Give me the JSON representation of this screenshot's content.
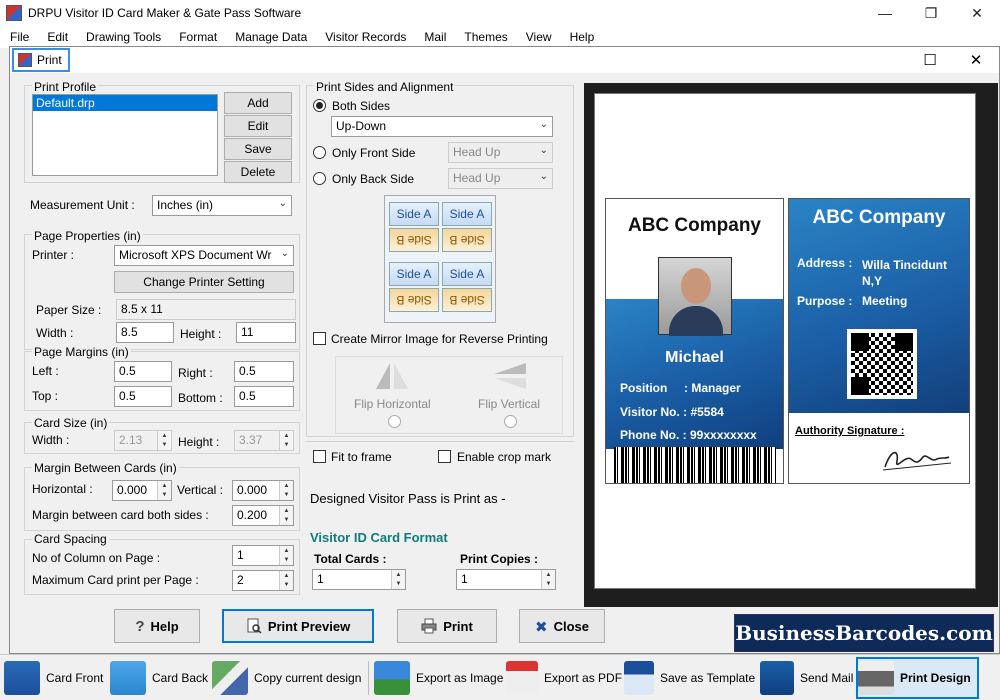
{
  "app": {
    "title": "DRPU Visitor ID Card Maker & Gate Pass Software",
    "menu": [
      "File",
      "Edit",
      "Drawing Tools",
      "Format",
      "Manage Data",
      "Visitor Records",
      "Mail",
      "Themes",
      "View",
      "Help"
    ]
  },
  "dialog": {
    "title": "Print",
    "print_profile": {
      "label": "Print Profile",
      "selected_item": "Default.drp",
      "buttons": [
        "Add",
        "Edit",
        "Save",
        "Delete"
      ]
    },
    "measurement": {
      "label": "Measurement Unit :",
      "value": "Inches (in)"
    },
    "page_properties": {
      "label": "Page Properties (in)",
      "printer_label": "Printer :",
      "printer_value": "Microsoft XPS Document Wr",
      "change_printer": "Change Printer Setting",
      "paper_size_label": "Paper Size :",
      "paper_size_value": "8.5 x 11",
      "width_label": "Width :",
      "width_value": "8.5",
      "height_label": "Height :",
      "height_value": "11"
    },
    "page_margins": {
      "label": "Page Margins (in)",
      "left_label": "Left :",
      "left_value": "0.5",
      "right_label": "Right :",
      "right_value": "0.5",
      "top_label": "Top :",
      "top_value": "0.5",
      "bottom_label": "Bottom :",
      "bottom_value": "0.5"
    },
    "card_size": {
      "label": "Card Size (in)",
      "width_label": "Width :",
      "width_value": "2.13",
      "height_label": "Height :",
      "height_value": "3.37"
    },
    "margin_between": {
      "label": "Margin Between Cards (in)",
      "horizontal_label": "Horizontal :",
      "horizontal_value": "0.000",
      "vertical_label": "Vertical :",
      "vertical_value": "0.000",
      "both_sides_label": "Margin between card both sides :",
      "both_sides_value": "0.200"
    },
    "card_spacing": {
      "label": "Card Spacing",
      "columns_label": "No of Column on Page :",
      "columns_value": "1",
      "max_label": "Maximum Card print per Page :",
      "max_value": "2"
    },
    "print_sides": {
      "label": "Print Sides and Alignment",
      "both_sides": "Both Sides",
      "both_sides_value": "Up-Down",
      "front_only": "Only Front Side",
      "front_value": "Head Up",
      "back_only": "Only Back Side",
      "back_value": "Head Up",
      "side_a": "Side A",
      "side_b": "Side B",
      "mirror": "Create Mirror Image for Reverse Printing",
      "flip_h": "Flip Horizontal",
      "flip_v": "Flip Vertical",
      "fit_frame": "Fit to frame",
      "crop_mark": "Enable crop mark"
    },
    "designed_text": "Designed Visitor Pass is Print as -",
    "format_title": "Visitor ID Card Format",
    "total_cards_label": "Total Cards :",
    "total_cards_value": "1",
    "print_copies_label": "Print Copies :",
    "print_copies_value": "1",
    "buttons": {
      "help": "Help",
      "preview": "Print Preview",
      "print": "Print",
      "close": "Close"
    }
  },
  "card": {
    "front": {
      "company": "ABC Company",
      "name": "Michael",
      "position": "Position     : Manager",
      "visitor_no": "Visitor No. : #5584",
      "phone": "Phone No. : 99xxxxxxxx"
    },
    "back": {
      "company": "ABC Company",
      "address_label": "Address :",
      "address_value_1": "Willa Tincidunt",
      "address_value_2": "N,Y",
      "purpose_label": "Purpose :",
      "purpose_value": "Meeting",
      "signature_label": "Authority Signature :"
    }
  },
  "watermark": "BusinessBarcodes.com",
  "toolbar": {
    "items": [
      "Card Front",
      "Card Back",
      "Copy current design",
      "Export as Image",
      "Export as PDF",
      "Save as Template",
      "Send Mail",
      "Print Design"
    ]
  },
  "colors": {
    "accent": "#0078d7",
    "card_blue": "#1b5fa7",
    "format_title": "#107b7b"
  }
}
